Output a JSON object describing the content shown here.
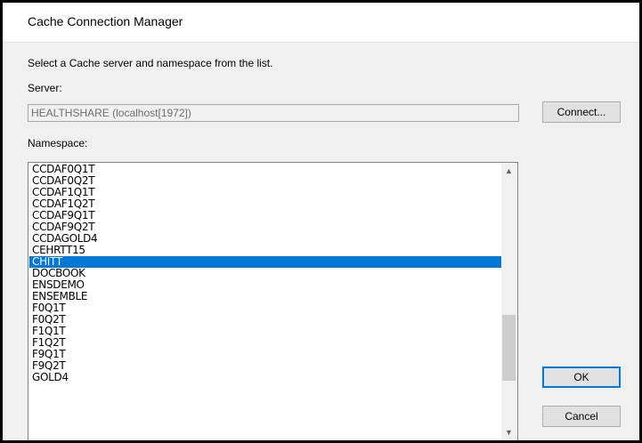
{
  "window": {
    "title": "Cache Connection Manager"
  },
  "instruction": "Select a Cache server and namespace from the list.",
  "server": {
    "label": "Server:",
    "value": "HEALTHSHARE (localhost[1972])",
    "connect_label": "Connect..."
  },
  "namespace": {
    "label": "Namespace:",
    "items": [
      "CCDAF0Q1T",
      "CCDAF0Q2T",
      "CCDAF1Q1T",
      "CCDAF1Q2T",
      "CCDAF9Q1T",
      "CCDAF9Q2T",
      "CCDAGOLD4",
      "CEHRTT15",
      "CHITT",
      "DOCBOOK",
      "ENSDEMO",
      "ENSEMBLE",
      "F0Q1T",
      "F0Q2T",
      "F1Q1T",
      "F1Q2T",
      "F9Q1T",
      "F9Q2T",
      "GOLD4"
    ],
    "selected": "CHITT"
  },
  "scrollbar": {
    "up_icon": "▲",
    "down_icon": "▼"
  },
  "buttons": {
    "ok_label": "OK",
    "cancel_label": "Cancel"
  },
  "colors": {
    "selection": "#0078d7"
  }
}
